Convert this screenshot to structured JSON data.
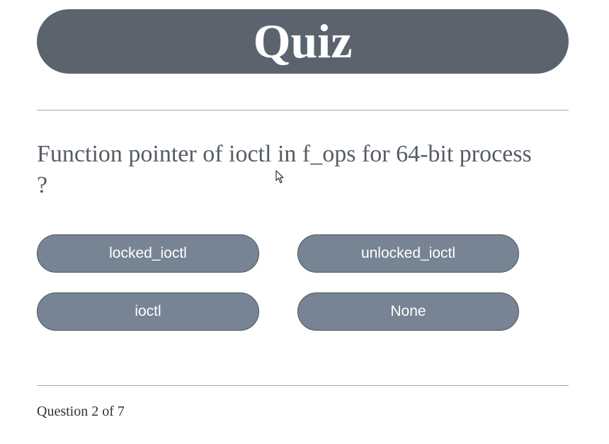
{
  "header": {
    "title": "Quiz"
  },
  "question": {
    "text": "Function pointer of ioctl in f_ops for 64-bit process ?"
  },
  "answers": [
    {
      "label": "locked_ioctl"
    },
    {
      "label": "unlocked_ioctl"
    },
    {
      "label": "ioctl"
    },
    {
      "label": "None"
    }
  ],
  "footer": {
    "progress_text": "Question 2 of 7"
  },
  "colors": {
    "header_bg": "#5b646e",
    "answer_bg": "#768493",
    "question_text": "#555d66"
  }
}
